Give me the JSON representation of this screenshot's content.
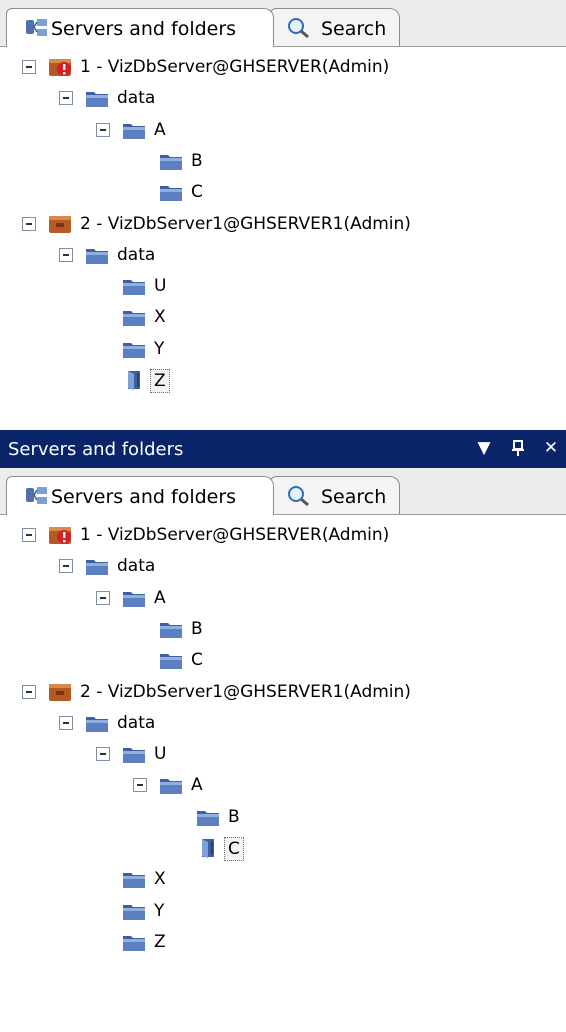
{
  "panel1": {
    "tabs": {
      "servers_label": "Servers and folders",
      "search_label": "Search"
    },
    "tree": [
      {
        "label": "1 - VizDbServer@GHSERVER(Admin)",
        "type": "server-error",
        "expanded": true
      },
      {
        "label": "data",
        "type": "folder",
        "expanded": true
      },
      {
        "label": "A",
        "type": "folder",
        "expanded": true
      },
      {
        "label": "B",
        "type": "folder"
      },
      {
        "label": "C",
        "type": "folder"
      },
      {
        "label": "2 - VizDbServer1@GHSERVER1(Admin)",
        "type": "server",
        "expanded": true
      },
      {
        "label": "data",
        "type": "folder",
        "expanded": true
      },
      {
        "label": "U",
        "type": "folder"
      },
      {
        "label": "X",
        "type": "folder"
      },
      {
        "label": "Y",
        "type": "folder"
      },
      {
        "label": "Z",
        "type": "folder-open",
        "selected": true
      }
    ]
  },
  "panel2": {
    "titlebar": {
      "title": "Servers and folders",
      "dropdown_icon": "▼",
      "pin_icon": "ꟾ",
      "close_icon": "✕"
    },
    "tabs": {
      "servers_label": "Servers and folders",
      "search_label": "Search"
    },
    "tree": [
      {
        "label": "1 - VizDbServer@GHSERVER(Admin)",
        "type": "server-error",
        "expanded": true
      },
      {
        "label": "data",
        "type": "folder",
        "expanded": true
      },
      {
        "label": "A",
        "type": "folder",
        "expanded": true
      },
      {
        "label": "B",
        "type": "folder"
      },
      {
        "label": "C",
        "type": "folder"
      },
      {
        "label": "2 - VizDbServer1@GHSERVER1(Admin)",
        "type": "server",
        "expanded": true
      },
      {
        "label": "data",
        "type": "folder",
        "expanded": true
      },
      {
        "label": "U",
        "type": "folder",
        "expanded": true
      },
      {
        "label": "A",
        "type": "folder",
        "expanded": true
      },
      {
        "label": "B",
        "type": "folder"
      },
      {
        "label": "C",
        "type": "folder-open",
        "selected": true
      },
      {
        "label": "X",
        "type": "folder"
      },
      {
        "label": "Y",
        "type": "folder"
      },
      {
        "label": "Z",
        "type": "folder"
      }
    ]
  },
  "colors": {
    "titlebar": "#0a246a",
    "folder": "#4f6fae",
    "server": "#a0522d",
    "error_badge": "#d42020"
  }
}
